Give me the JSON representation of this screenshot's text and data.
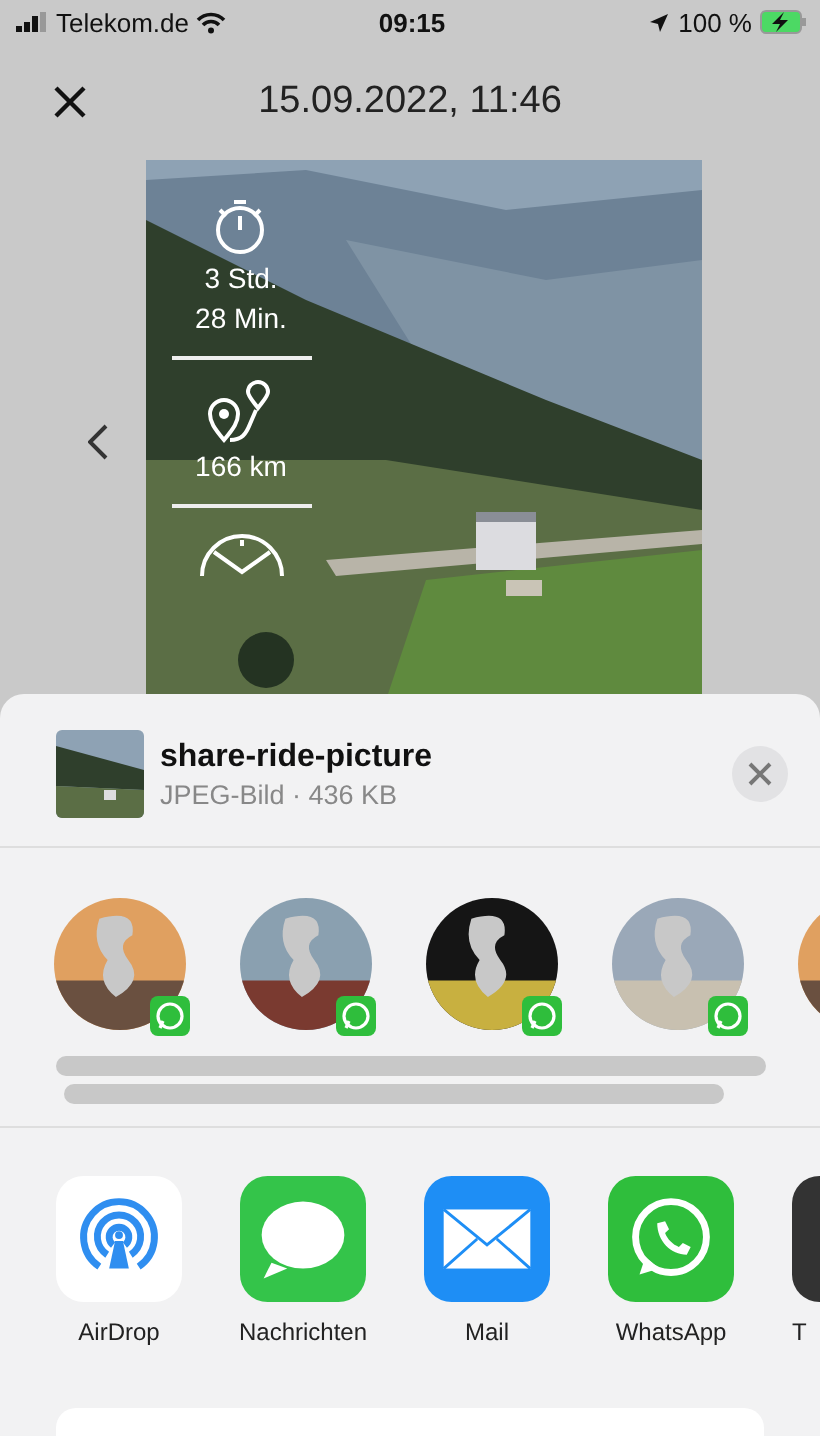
{
  "status_bar": {
    "carrier": "Telekom.de",
    "time": "09:15",
    "battery": "100 %"
  },
  "header": {
    "title": "15.09.2022, 11:46"
  },
  "preview": {
    "kind": "picture",
    "stats": [
      {
        "kind": "duration",
        "lines": [
          "3 Std.",
          "28 Min."
        ]
      },
      {
        "kind": "distance",
        "lines": [
          "166 km"
        ]
      },
      {
        "kind": "speed"
      }
    ]
  },
  "share_sheet": {
    "file_name": "share-ride-picture",
    "file_info": "JPEG-Bild · 436 KB",
    "contacts": [
      {
        "kind": "whatsapp"
      },
      {
        "kind": "whatsapp"
      },
      {
        "kind": "whatsapp"
      },
      {
        "kind": "whatsapp"
      },
      {
        "kind": "partial"
      }
    ],
    "apps": [
      {
        "kind": "airdrop",
        "label": "AirDrop"
      },
      {
        "kind": "messages",
        "label": "Nachrichten"
      },
      {
        "kind": "mail",
        "label": "Mail"
      },
      {
        "kind": "whatsapp",
        "label": "WhatsApp"
      },
      {
        "kind": "other",
        "label": "T"
      }
    ]
  }
}
